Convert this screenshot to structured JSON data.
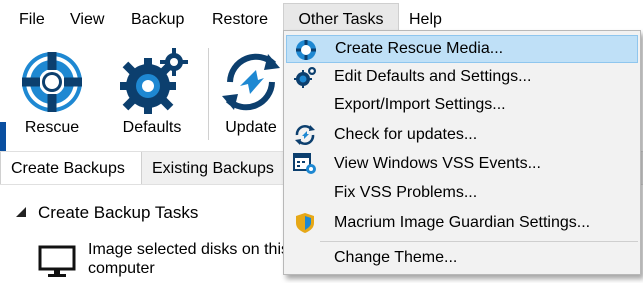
{
  "menu": {
    "file": "File",
    "view": "View",
    "backup": "Backup",
    "restore": "Restore",
    "other_tasks": "Other Tasks",
    "help": "Help"
  },
  "ribbon": {
    "rescue": "Rescue",
    "defaults": "Defaults",
    "update": "Update"
  },
  "tabs": {
    "create_backups": "Create Backups",
    "existing_backups": "Existing Backups"
  },
  "content": {
    "group_title": "Create Backup Tasks",
    "task_image_disks": "Image selected disks on this computer"
  },
  "dropdown": {
    "items": [
      {
        "label": "Create Rescue Media...",
        "icon": "lifebuoy-icon",
        "highlighted": true
      },
      {
        "label": "Edit Defaults and Settings...",
        "icon": "gears-icon"
      },
      {
        "label": "Export/Import Settings...",
        "icon": ""
      },
      {
        "label": "Check for updates...",
        "icon": "refresh-icon"
      },
      {
        "label": "View Windows VSS Events...",
        "icon": "calendar-gear-icon"
      },
      {
        "label": "Fix VSS Problems...",
        "icon": ""
      },
      {
        "label": "Macrium Image Guardian Settings...",
        "icon": "shield-icon"
      },
      {
        "label": "Change Theme...",
        "icon": ""
      }
    ]
  },
  "colors": {
    "accent_blue": "#1e88d2",
    "dark_navy": "#0c3f6e",
    "highlight": "#bfe0f7",
    "shield_gold": "#e6a817"
  }
}
